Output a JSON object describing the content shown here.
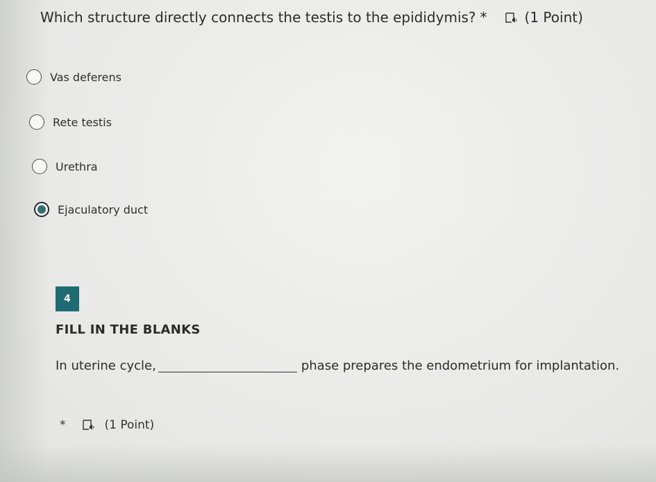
{
  "question3": {
    "title": "Which structure directly connects the testis to the epididymis?",
    "required_mark": "*",
    "speaker_icon": "immersive-reader-icon",
    "points": "(1 Point)",
    "options": [
      {
        "label": "Vas deferens",
        "selected": false
      },
      {
        "label": "Rete testis",
        "selected": false
      },
      {
        "label": "Urethra",
        "selected": false
      },
      {
        "label": "Ejaculatory duct",
        "selected": true
      }
    ]
  },
  "question4": {
    "number": "4",
    "section_title": "FILL IN THE BLANKS",
    "sentence_start": "In uterine cycle,",
    "sentence_end": "phase prepares the endometrium for implantation.",
    "required_mark": "*",
    "speaker_icon": "immersive-reader-icon",
    "points": "(1 Point)"
  },
  "colors": {
    "accent": "#1f6b74",
    "radio_fill": "#2e6f72",
    "background": "#ebebea"
  }
}
